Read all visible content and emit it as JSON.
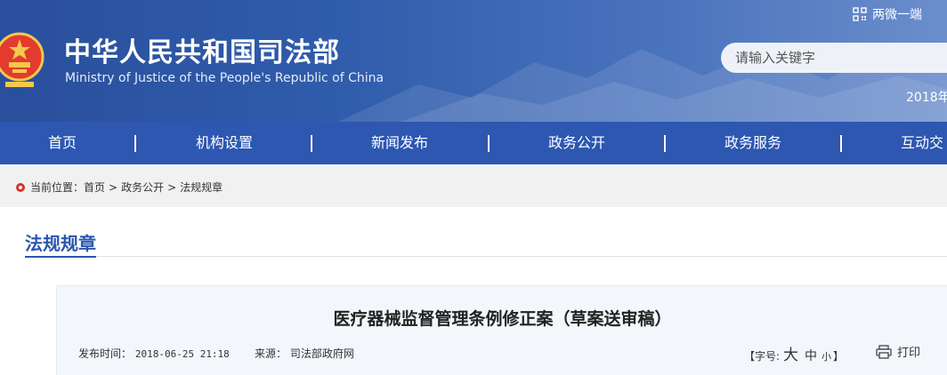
{
  "header": {
    "title": "中华人民共和国司法部",
    "subtitle": "Ministry of Justice of the People's Republic of China",
    "top_link": "两微一端",
    "search_placeholder": "请输入关键字",
    "date_partial": "2018年"
  },
  "nav": {
    "items": [
      {
        "label": "首页"
      },
      {
        "label": "机构设置"
      },
      {
        "label": "新闻发布"
      },
      {
        "label": "政务公开"
      },
      {
        "label": "政务服务"
      },
      {
        "label": "互动交"
      }
    ]
  },
  "breadcrumb": {
    "prefix": "当前位置：",
    "items": [
      "首页",
      "政务公开",
      "法规规章"
    ],
    "separator": ">"
  },
  "section": {
    "title": "法规规章"
  },
  "article": {
    "title": "医疗器械监督管理条例修正案（草案送审稿）",
    "publish_label": "发布时间：",
    "publish_time": "2018-06-25 21:18",
    "source_label": "来源：",
    "source": "司法部政府网",
    "font_size_label": "【字号:",
    "font_large": "大",
    "font_medium": "中",
    "font_small": "小",
    "font_size_close": "】",
    "print_label": "打印"
  },
  "colors": {
    "nav_bg": "#2d57b0",
    "accent": "#2a56b0",
    "crumb_bg": "#f1f1f1",
    "card_bg": "#f3f6fb"
  }
}
